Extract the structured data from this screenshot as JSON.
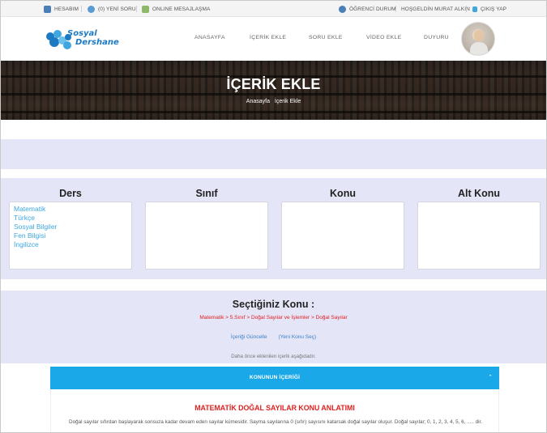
{
  "topbar": {
    "left": [
      {
        "label": "HESABIM",
        "icon": "account-icon"
      },
      {
        "label": "(0) YENİ SORU",
        "icon": "question-icon"
      },
      {
        "label": "ONLINE MESAJLAŞMA",
        "icon": "chat-icon"
      }
    ],
    "right": [
      {
        "label": "ÖĞRENCİ DURUM",
        "icon": "student-icon"
      },
      {
        "label": "HOŞGELDİN MURAT ALKIN"
      },
      {
        "label": "ÇIKIŞ YAP",
        "icon": "lock-icon"
      }
    ]
  },
  "logo": {
    "line1": "Sosyal",
    "line2": "Dershane"
  },
  "nav": [
    "ANASAYFA",
    "İÇERİK EKLE",
    "SORU EKLE",
    "VİDEO EKLE",
    "DUYURU"
  ],
  "banner": {
    "title": "İÇERİK EKLE",
    "breadcrumb_home": "Anasayfa",
    "breadcrumb_current": "İçerik Ekle"
  },
  "selectors": {
    "ders": {
      "title": "Ders",
      "options": [
        "Matematik",
        "Türkçe",
        "Sosyal Bilgiler",
        "Fen Bilgisi",
        "İngilizce"
      ]
    },
    "sinif": {
      "title": "Sınıf"
    },
    "konu": {
      "title": "Konu"
    },
    "alt_konu": {
      "title": "Alt Konu"
    }
  },
  "selection": {
    "title": "Seçtiğiniz Konu :",
    "path": "Matematik > 5.Sınıf > Doğal Sayılar ve İşlemler > Doğal Sayılar",
    "update_link": "İçeriği Güncelle",
    "new_topic_link": "(Yeni Konu Seç)",
    "note": "Daha önce eklenilen içerik aşağıdadır."
  },
  "content": {
    "bar_title": "KONUNUN İÇERİĞİ",
    "heading": "MATEMATİK DOĞAL SAYILAR KONU ANLATIMI",
    "text": "Doğal sayılar sıfırdan başlayarak sonsuza kadar devam eden sayılar kümesidir. Sayma sayılarına 0 (sıfır) sayısını katarsak doğal sayılar oluşur. Doğal sayılar; 0, 1, 2, 3, 4, 5, 6, ..... dir."
  },
  "colors": {
    "accent": "#1aa8e8",
    "link": "#3fa6e0",
    "path_red": "#e02020",
    "band": "#e5e5f8"
  }
}
